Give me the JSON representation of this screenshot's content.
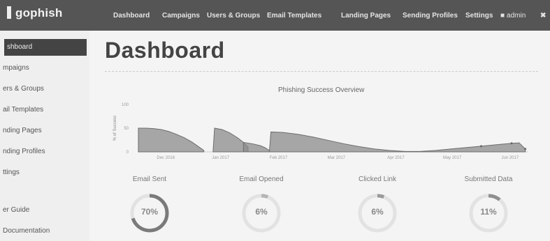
{
  "app": {
    "brand": "gophish"
  },
  "topnav": {
    "items": [
      "Dashboard",
      "Campaigns",
      "Users & Groups",
      "Email Templates",
      "Landing Pages",
      "Sending Profiles",
      "Settings"
    ],
    "user": "admin"
  },
  "sidebar": {
    "items": [
      "shboard",
      "mpaigns",
      "ers & Groups",
      "ail Templates",
      "nding Pages",
      "nding Profiles",
      "ttings",
      "er Guide",
      "Documentation"
    ],
    "active_index": 0
  },
  "page": {
    "title": "Dashboard"
  },
  "chart_data": {
    "type": "area",
    "title": "Phishing Success Overview",
    "xlabel": "",
    "ylabel": "% of Success",
    "y_ticks": [
      "100",
      "50",
      "0"
    ],
    "x_ticks": [
      "Dec 2016",
      "Jan 2017",
      "Feb 2017",
      "Mar 2017",
      "Apr 2017",
      "May 2017",
      "Jun 2017"
    ],
    "ylim": [
      0,
      100
    ],
    "segments": [
      {
        "x": [
          0,
          0.5,
          1,
          1.5,
          2,
          2.5,
          3,
          3.5,
          3.9,
          4.3
        ],
        "y": [
          50,
          50,
          49,
          47,
          43,
          37,
          30,
          21,
          12,
          3
        ]
      },
      {
        "x": [
          4.9,
          5.0,
          5.5,
          6.0,
          6.5,
          6.9,
          7.2
        ],
        "y": [
          0,
          50,
          47,
          40,
          30,
          20,
          10
        ]
      },
      {
        "x": [
          6.9,
          7.5,
          8.0,
          8.3,
          8.6
        ],
        "y": [
          20,
          17,
          13,
          9,
          3
        ]
      },
      {
        "x": [
          8.6,
          8.7,
          9.5,
          10.5,
          11.5,
          12.5,
          13.5,
          14.5,
          15.5,
          16.5,
          17.5,
          18.5,
          19.5,
          20.5,
          21.5,
          22.5,
          23.5,
          24.5,
          25.0,
          25.4
        ],
        "y": [
          0,
          42,
          41,
          37,
          31,
          24,
          17,
          11,
          6,
          3,
          1,
          1,
          3,
          6,
          9,
          12,
          15,
          18,
          19,
          6
        ]
      }
    ]
  },
  "stats": [
    {
      "label": "Email Sent",
      "value": "70%",
      "percent": 70,
      "color": "#7a7a7a"
    },
    {
      "label": "Email Opened",
      "value": "6%",
      "percent": 6,
      "color": "#b5b5b5"
    },
    {
      "label": "Clicked Link",
      "value": "6%",
      "percent": 6,
      "color": "#9a9a9a"
    },
    {
      "label": "Submitted Data",
      "value": "11%",
      "percent": 11,
      "color": "#8f8f8f"
    }
  ],
  "colors": {
    "topbar": "#555555",
    "sidebar_active": "#444444",
    "area_fill": "#8c8c8c"
  }
}
